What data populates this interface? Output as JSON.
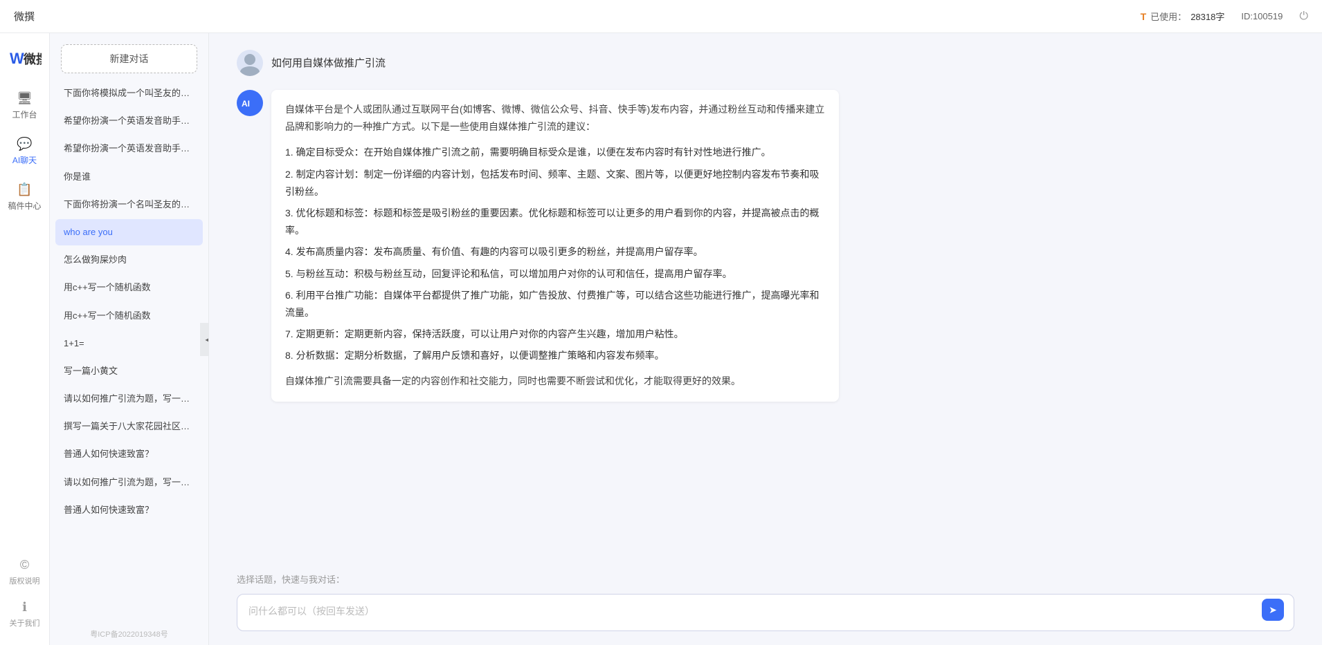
{
  "topbar": {
    "title": "微撰",
    "token_label": "已使用：",
    "token_value": "28318字",
    "id_label": "ID:100519",
    "power_icon": "⏻"
  },
  "left_nav": {
    "logo_text": "微撰",
    "items": [
      {
        "id": "workbench",
        "icon": "🖥",
        "label": "工作台"
      },
      {
        "id": "ai-chat",
        "icon": "💬",
        "label": "AI聊天",
        "active": true
      },
      {
        "id": "drafts",
        "icon": "📋",
        "label": "稿件中心"
      }
    ],
    "bottom_items": [
      {
        "id": "copyright",
        "icon": "©",
        "label": "版权说明"
      },
      {
        "id": "about",
        "icon": "ℹ",
        "label": "关于我们"
      }
    ]
  },
  "history_sidebar": {
    "new_chat_label": "新建对话",
    "items": [
      {
        "id": "h1",
        "text": "下面你将模拟成一个叫圣友的程序员，我说...",
        "active": false
      },
      {
        "id": "h2",
        "text": "希望你扮演一个英语发音助手，我提供给你...",
        "active": false
      },
      {
        "id": "h3",
        "text": "希望你扮演一个英语发音助手，我提供给你...",
        "active": false
      },
      {
        "id": "h4",
        "text": "你是谁",
        "active": false
      },
      {
        "id": "h5",
        "text": "下面你将扮演一个名叫圣友的医生",
        "active": false
      },
      {
        "id": "h6",
        "text": "who are you",
        "active": true
      },
      {
        "id": "h7",
        "text": "怎么做狗屎炒肉",
        "active": false
      },
      {
        "id": "h8",
        "text": "用c++写一个随机函数",
        "active": false
      },
      {
        "id": "h9",
        "text": "用c++写一个随机函数",
        "active": false
      },
      {
        "id": "h10",
        "text": "1+1=",
        "active": false
      },
      {
        "id": "h11",
        "text": "写一篇小黄文",
        "active": false
      },
      {
        "id": "h12",
        "text": "请以如何推广引流为题，写一篇大纲",
        "active": false
      },
      {
        "id": "h13",
        "text": "撰写一篇关于八大家花园社区一刻钟便民生...",
        "active": false
      },
      {
        "id": "h14",
        "text": "普通人如何快速致富？",
        "active": false
      },
      {
        "id": "h15",
        "text": "请以如何推广引流为题，写一篇大纲",
        "active": false
      },
      {
        "id": "h16",
        "text": "普通人如何快速致富？",
        "active": false
      }
    ],
    "icp_text": "粤ICP备2022019348号"
  },
  "chat": {
    "user_message": "如何用自媒体做推广引流",
    "ai_intro": "自媒体平台是个人或团队通过互联网平台(如博客、微博、微信公众号、抖音、快手等)发布内容，并通过粉丝互动和传播来建立品牌和影响力的一种推广方式。以下是一些使用自媒体推广引流的建议：",
    "points": [
      "1. 确定目标受众：在开始自媒体推广引流之前，需要明确目标受众是谁，以便在发布内容时有针对性地进行推广。",
      "2. 制定内容计划：制定一份详细的内容计划，包括发布时间、频率、主题、文案、图片等，以便更好地控制内容发布节奏和吸引粉丝。",
      "3. 优化标题和标签：标题和标签是吸引粉丝的重要因素。优化标题和标签可以让更多的用户看到你的内容，并提高被点击的概率。",
      "4. 发布高质量内容：发布高质量、有价值、有趣的内容可以吸引更多的粉丝，并提高用户留存率。",
      "5. 与粉丝互动：积极与粉丝互动，回复评论和私信，可以增加用户对你的认可和信任，提高用户留存率。",
      "6. 利用平台推广功能：自媒体平台都提供了推广功能，如广告投放、付费推广等，可以结合这些功能进行推广，提高曝光率和流量。",
      "7. 定期更新：定期更新内容，保持活跃度，可以让用户对你的内容产生兴趣，增加用户粘性。",
      "8. 分析数据：定期分析数据，了解用户反馈和喜好，以便调整推广策略和内容发布频率。"
    ],
    "conclusion": "自媒体推广引流需要具备一定的内容创作和社交能力，同时也需要不断尝试和优化，才能取得更好的效果。"
  },
  "input": {
    "quick_topics_label": "选择话题，快速与我对话：",
    "placeholder": "问什么都可以（按回车发送）",
    "send_icon": "➤"
  }
}
